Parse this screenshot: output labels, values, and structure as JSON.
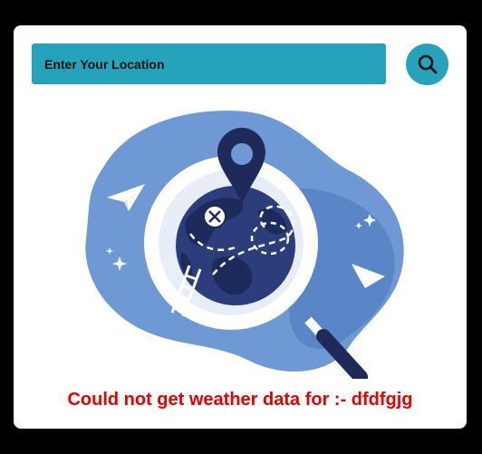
{
  "search": {
    "placeholder": "Enter Your Location",
    "value": ""
  },
  "search_button": {
    "icon": "search-icon"
  },
  "illustration": {
    "description_icon": "location-globe-magnifier-illustration"
  },
  "error": {
    "message": "Could not get weather data for :- dfdfgjg"
  },
  "colors": {
    "accent": "#26a3ba",
    "error": "#e60000",
    "blob_light": "#6e99d4",
    "blob_mid": "#5a86c7",
    "navy": "#1f2a5a",
    "globe": "#2b3d7a"
  }
}
